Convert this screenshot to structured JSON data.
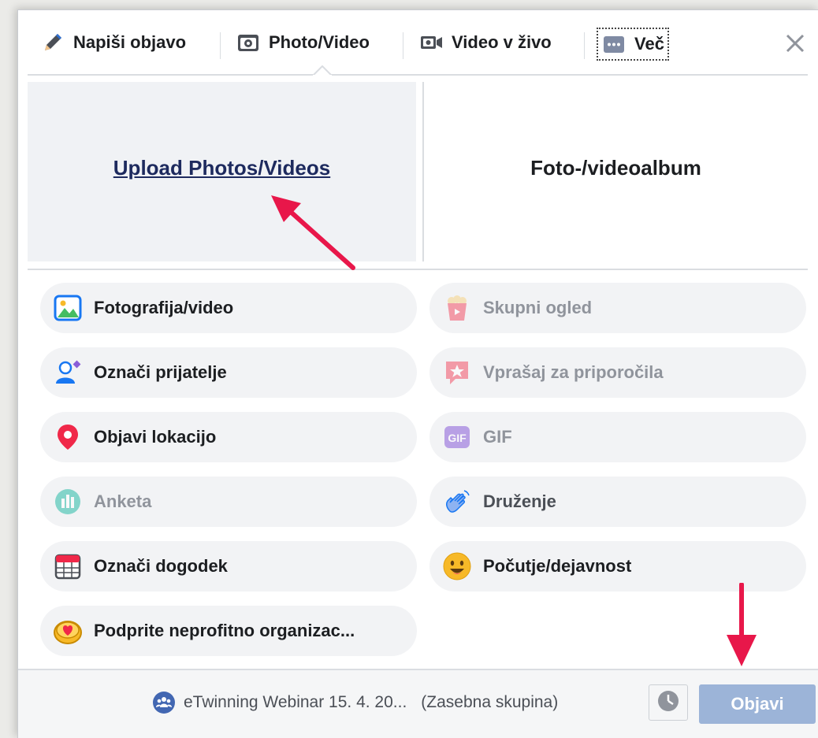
{
  "tabs": {
    "write_post": "Napiši objavo",
    "photo_video": "Photo/Video",
    "live_video": "Video v živo",
    "more": "Več"
  },
  "upload": {
    "upload_link": "Upload Photos/Videos",
    "album": "Foto-/videoalbum"
  },
  "options": {
    "photo_video": "Fotografija/video",
    "watch_party": "Skupni ogled",
    "tag_friends": "Označi prijatelje",
    "ask_recommendations": "Vprašaj za priporočila",
    "check_in": "Objavi lokacijo",
    "gif": "GIF",
    "poll": "Anketa",
    "hangout": "Druženje",
    "tag_event": "Označi dogodek",
    "feeling_activity": "Počutje/dejavnost",
    "support_nonprofit": "Podprite neprofitno organizac..."
  },
  "footer": {
    "group_name": "eTwinning Webinar 15. 4. 20...",
    "privacy": "(Zasebna skupina)",
    "post_button": "Objavi"
  },
  "colors": {
    "accent_arrow": "#e8174a",
    "post_button_bg": "#9cb4d8",
    "link_text": "#1d2a5e"
  }
}
